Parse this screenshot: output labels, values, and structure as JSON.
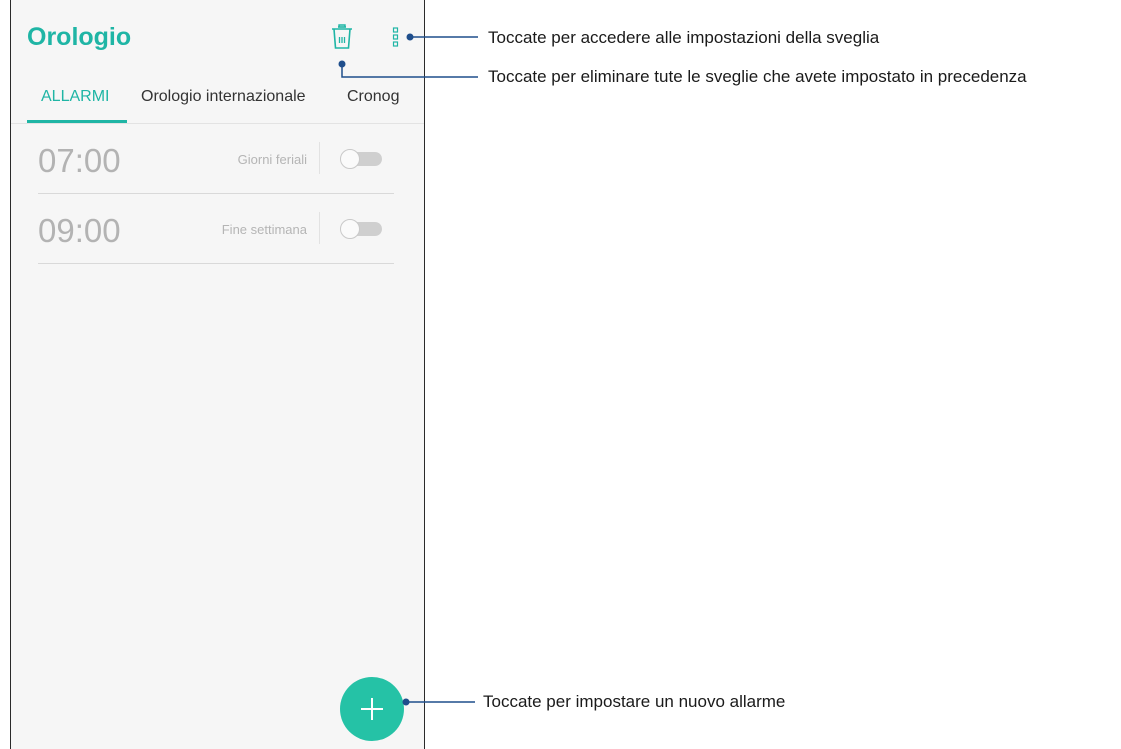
{
  "app": {
    "title": "Orologio"
  },
  "toolbar": {
    "delete_icon": "trash-icon",
    "more_icon": "more-vert-icon"
  },
  "tabs": [
    {
      "label": "ALLARMI",
      "active": true
    },
    {
      "label": "Orologio internazionale",
      "active": false
    },
    {
      "label": "Cronog",
      "active": false
    }
  ],
  "alarms": [
    {
      "time": "07:00",
      "days": "Giorni feriali",
      "enabled": false
    },
    {
      "time": "09:00",
      "days": "Fine settimana",
      "enabled": false
    }
  ],
  "fab": {
    "icon": "plus-icon"
  },
  "callouts": {
    "settings": "Toccate per accedere alle impostazioni della sveglia",
    "delete_all": "Toccate per eliminare tute le sveglie che avete impostato in precedenza",
    "add_alarm": "Toccate per impostare un nuovo allarme"
  },
  "colors": {
    "accent": "#1fb5a5",
    "callout_line": "#1f4e8c"
  }
}
